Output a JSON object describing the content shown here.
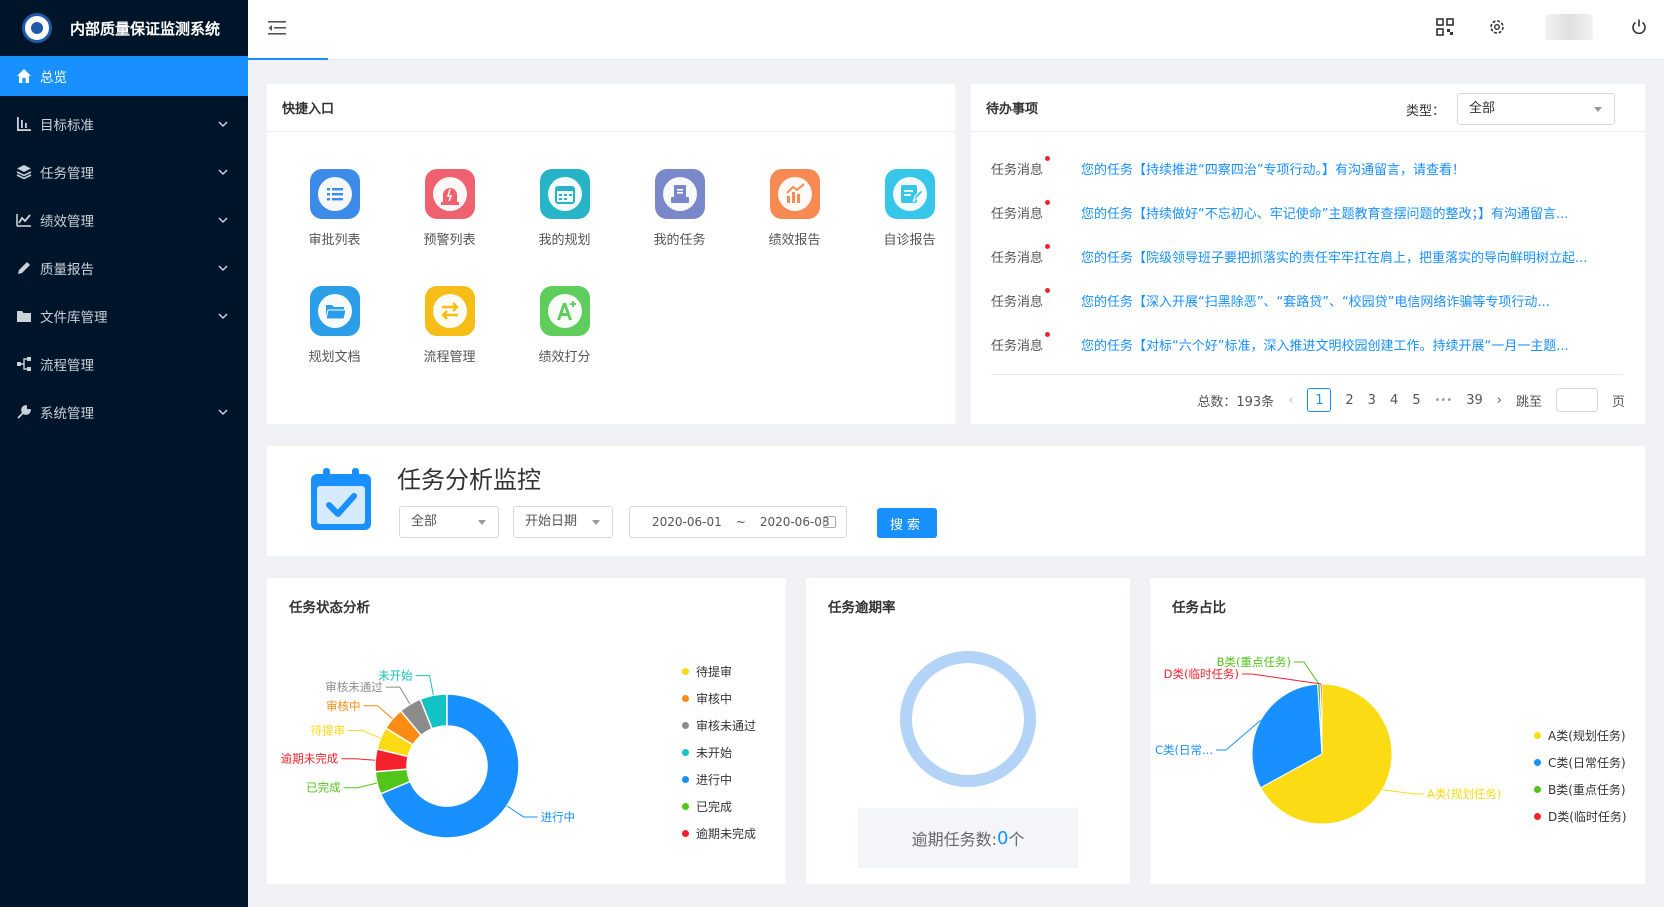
{
  "app": {
    "title": "内部质量保证监测系统"
  },
  "sidebar": {
    "items": [
      {
        "label": "总览",
        "icon": "home-icon",
        "active": true
      },
      {
        "label": "目标标准",
        "icon": "target-icon",
        "has_children": true
      },
      {
        "label": "任务管理",
        "icon": "layers-icon",
        "has_children": true
      },
      {
        "label": "绩效管理",
        "icon": "chart-icon",
        "has_children": true
      },
      {
        "label": "质量报告",
        "icon": "edit-icon",
        "has_children": true
      },
      {
        "label": "文件库管理",
        "icon": "folder-icon",
        "has_children": true
      },
      {
        "label": "流程管理",
        "icon": "flow-icon",
        "has_children": false
      },
      {
        "label": "系统管理",
        "icon": "tool-icon",
        "has_children": true
      }
    ]
  },
  "quick_entry": {
    "title": "快捷入口",
    "items": [
      {
        "label": "审批列表",
        "color": "#3d8be8",
        "icon": "list-icon"
      },
      {
        "label": "预警列表",
        "color": "#f0616f",
        "icon": "alarm-icon"
      },
      {
        "label": "我的规划",
        "color": "#26b4c6",
        "icon": "calendar-icon"
      },
      {
        "label": "我的任务",
        "color": "#7a87c8",
        "icon": "task-icon"
      },
      {
        "label": "绩效报告",
        "color": "#f78a52",
        "icon": "report-chart-icon"
      },
      {
        "label": "自诊报告",
        "color": "#35c6ea",
        "icon": "note-icon"
      },
      {
        "label": "规划文档",
        "color": "#2b9ee8",
        "icon": "folder-open-icon"
      },
      {
        "label": "流程管理",
        "color": "#f6bd16",
        "icon": "swap-icon"
      },
      {
        "label": "绩效打分",
        "color": "#5fcd5b",
        "icon": "grade-icon"
      }
    ]
  },
  "todo": {
    "title": "待办事项",
    "type_label": "类型：",
    "type_value": "全部",
    "items": [
      {
        "tag": "任务消息",
        "text": "您的任务【持续推进“四察四治”专项行动。】有沟通留言，请查看！"
      },
      {
        "tag": "任务消息",
        "text": "您的任务【持续做好“不忘初心、牢记使命”主题教育查摆问题的整改；】有沟通留言..."
      },
      {
        "tag": "任务消息",
        "text": "您的任务【院级领导班子要把抓落实的责任牢牢扛在肩上，把重落实的导向鲜明树立起..."
      },
      {
        "tag": "任务消息",
        "text": "您的任务【深入开展“扫黑除恶”、“套路贷”、“校园贷”电信网络诈骗等专项行动..."
      },
      {
        "tag": "任务消息",
        "text": "您的任务【对标“六个好”标准，深入推进文明校园创建工作。持续开展“一月一主题..."
      }
    ],
    "pagination": {
      "total": "总数：193条",
      "prev": "‹",
      "pages": [
        "1",
        "2",
        "3",
        "4",
        "5"
      ],
      "ellipsis": "•••",
      "last": "39",
      "next": "›",
      "jump_label": "跳至",
      "page_unit": "页"
    }
  },
  "monitor": {
    "title": "任务分析监控",
    "scope": "全部",
    "date_type": "开始日期",
    "date_start": "2020-06-01",
    "date_sep": "~",
    "date_end": "2020-06-08",
    "search_label": "搜索"
  },
  "status_chart": {
    "title": "任务状态分析",
    "chart_data": {
      "type": "pie",
      "donut": true,
      "categories": [
        "待提审",
        "审核中",
        "审核未通过",
        "未开始",
        "进行中",
        "已完成",
        "逾期未完成"
      ],
      "values": [
        5,
        5,
        5,
        6,
        68,
        5,
        5
      ],
      "colors": [
        "#fadb14",
        "#fa8c16",
        "#8c8c8c",
        "#13c2c2",
        "#1890ff",
        "#52c41a",
        "#f5222d"
      ],
      "legend": "right"
    }
  },
  "overdue_chart": {
    "title": "任务逾期率",
    "label": "逾期任务数:",
    "count": "0",
    "unit": "个",
    "chart_data": {
      "type": "pie",
      "donut": true,
      "categories": [],
      "values": [],
      "ring_color": "#b3d4f7"
    }
  },
  "ratio_chart": {
    "title": "任务占比",
    "chart_data": {
      "type": "pie",
      "categories": [
        "A类(规划任务)",
        "C类(日常任务)",
        "B类(重点任务)",
        "D类(临时任务)"
      ],
      "values": [
        67,
        32,
        0.6,
        0.4
      ],
      "colors": [
        "#fadb14",
        "#1890ff",
        "#52c41a",
        "#f5222d"
      ],
      "slice_labels": [
        "A类(规划任务)",
        "C类(日常...",
        "B类(重点任务)",
        "D类(临时任务)"
      ],
      "legend": "right"
    }
  }
}
